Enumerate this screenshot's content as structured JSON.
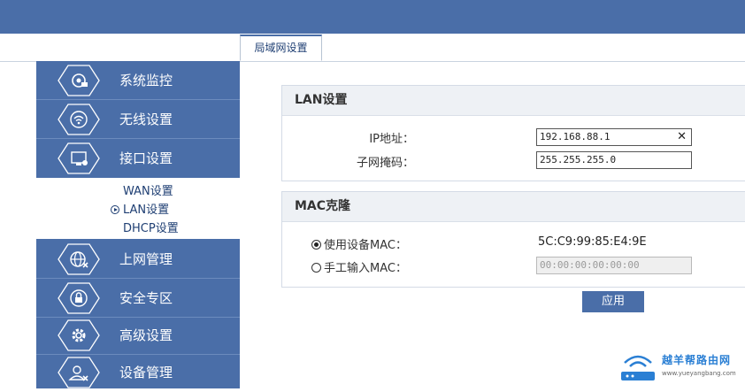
{
  "header": {
    "tab_label": "局域网设置"
  },
  "colors": {
    "sidebar": "#4a6ea8",
    "accent_text": "#1f3f73",
    "panel_header": "#eef1f5"
  },
  "sidebar": {
    "items": [
      {
        "label": "系统监控",
        "icon": "system-monitor-icon"
      },
      {
        "label": "无线设置",
        "icon": "wireless-icon"
      },
      {
        "label": "接口设置",
        "icon": "interface-icon"
      },
      {
        "label": "上网管理",
        "icon": "internet-icon"
      },
      {
        "label": "安全专区",
        "icon": "security-icon"
      },
      {
        "label": "高级设置",
        "icon": "advanced-gear-icon"
      },
      {
        "label": "设备管理",
        "icon": "device-management-icon"
      }
    ],
    "submenu": [
      {
        "label": "WAN设置",
        "active": false
      },
      {
        "label": "LAN设置",
        "active": true
      },
      {
        "label": "DHCP设置",
        "active": false
      }
    ]
  },
  "lan": {
    "title": "LAN设置",
    "ip_label": "IP地址：",
    "ip_value": "192.168.88.1",
    "mask_label": "子网掩码：",
    "mask_value": "255.255.255.0"
  },
  "mac": {
    "title": "MAC克隆",
    "use_device_label": "使用设备MAC：",
    "device_mac": "5C:C9:99:85:E4:9E",
    "manual_label": "手工输入MAC：",
    "manual_placeholder": "00:00:00:00:00:00",
    "selected": "use_device"
  },
  "actions": {
    "apply_label": "应用"
  },
  "watermark": {
    "text": "越羊帮路由网",
    "url": "www.yueyangbang.com"
  }
}
